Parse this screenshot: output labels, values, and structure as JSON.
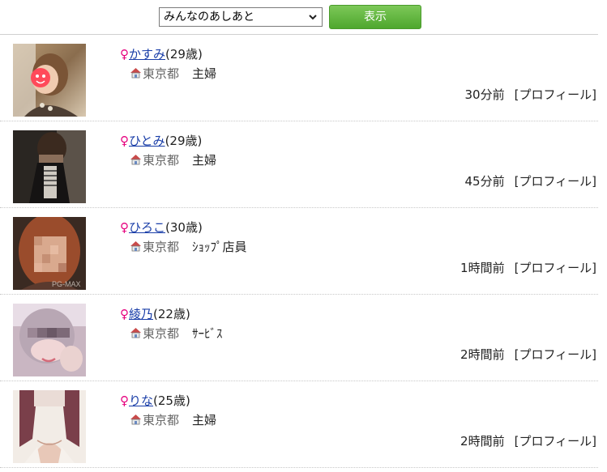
{
  "filter": {
    "selected": "みんなのあしあと",
    "button_label": "表示"
  },
  "colors": {
    "female_symbol": "#e6007e",
    "link": "#1a3ea8",
    "button_green": "#5bb23a"
  },
  "female_symbol": "♀",
  "entries": [
    {
      "name": "かすみ",
      "age": "(29歳)",
      "prefecture": "東京都",
      "job": "主婦",
      "time": "30分前",
      "profile_link": "[プロフィール]"
    },
    {
      "name": "ひとみ",
      "age": "(29歳)",
      "prefecture": "東京都",
      "job": "主婦",
      "time": "45分前",
      "profile_link": "[プロフィール]"
    },
    {
      "name": "ひろこ",
      "age": "(30歳)",
      "prefecture": "東京都",
      "job": "ｼｮｯﾌﾟ店員",
      "time": "1時間前",
      "profile_link": "[プロフィール]"
    },
    {
      "name": "綾乃",
      "age": "(22歳)",
      "prefecture": "東京都",
      "job": "ｻｰﾋﾞｽ",
      "time": "2時間前",
      "profile_link": "[プロフィール]"
    },
    {
      "name": "りな",
      "age": "(25歳)",
      "prefecture": "東京都",
      "job": "主婦",
      "time": "2時間前",
      "profile_link": "[プロフィール]"
    }
  ],
  "icons": {
    "gender": "female-symbol-icon",
    "location": "house-icon",
    "dropdown": "chevron-down-icon"
  }
}
